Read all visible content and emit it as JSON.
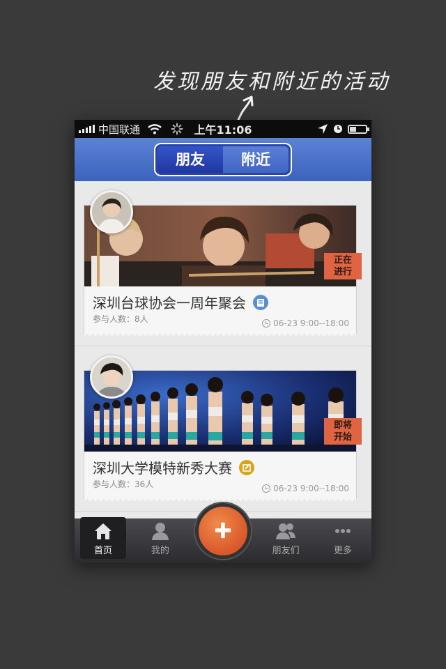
{
  "annotation": {
    "text": "发现朋友和附近的活动"
  },
  "statusbar": {
    "carrier": "中国联通",
    "time": "上午11:06"
  },
  "navbar": {
    "segments": [
      {
        "label": "朋友",
        "selected": true
      },
      {
        "label": "附近",
        "selected": false
      }
    ]
  },
  "events": [
    {
      "title": "深圳台球协会一周年聚会",
      "participants": "参与人数：8人",
      "datetime": "06-23 9:00--18:00",
      "status": [
        "正在",
        "进行"
      ],
      "type_icon": "bank-icon",
      "type_color": "#5a8fcc"
    },
    {
      "title": "深圳大学模特新秀大赛",
      "participants": "参与人数：36人",
      "datetime": "06-23 9:00--18:00",
      "status": [
        "即将",
        "开始"
      ],
      "type_icon": "edit-icon",
      "type_color": "#d6a51c"
    }
  ],
  "tabbar": {
    "items": [
      {
        "label": "首页",
        "icon": "home-icon",
        "active": true
      },
      {
        "label": "我的",
        "icon": "user-icon",
        "active": false
      },
      {
        "label": "",
        "icon": "plus-icon",
        "active": false
      },
      {
        "label": "朋友们",
        "icon": "users-icon",
        "active": false
      },
      {
        "label": "更多",
        "icon": "more-icon",
        "active": false
      }
    ]
  },
  "colors": {
    "navbar": "#4a72c9",
    "accent_orange": "#e06442",
    "background": "#3a3a3a"
  }
}
